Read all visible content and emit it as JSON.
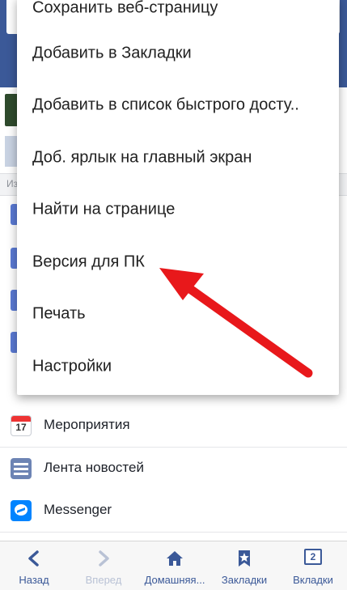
{
  "menu": {
    "items": [
      {
        "label": "Сохранить веб-страницу"
      },
      {
        "label": "Добавить в Закладки"
      },
      {
        "label": "Добавить в список быстрого досту.."
      },
      {
        "label": "Доб. ярлык на главный экран"
      },
      {
        "label": "Найти на странице"
      },
      {
        "label": "Версия для ПК"
      },
      {
        "label": "Печать"
      },
      {
        "label": "Настройки"
      }
    ]
  },
  "background": {
    "section_label": "Из",
    "rows": [
      {
        "label": "Мероприятия",
        "icon": "calendar-icon",
        "icon_text": "17"
      },
      {
        "label": "Лента новостей",
        "icon": "news-feed-icon"
      },
      {
        "label": "Messenger",
        "icon": "messenger-icon"
      }
    ]
  },
  "annotation": {
    "color": "#e8181b",
    "target": "Версия для ПК"
  },
  "toolbar": {
    "back": "Назад",
    "forward": "Вперед",
    "home": "Домашняя...",
    "bookmarks": "Закладки",
    "tabs": "Вкладки",
    "tabs_count": "2"
  },
  "colors": {
    "brand": "#3b5998",
    "accent": "#e8181b"
  }
}
